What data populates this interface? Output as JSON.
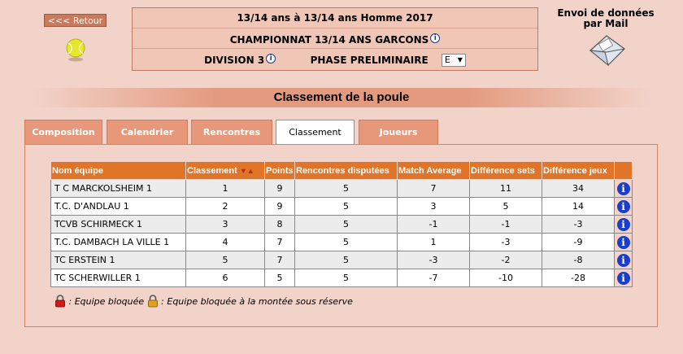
{
  "nav": {
    "back_label": "<<< Retour"
  },
  "header": {
    "line1": "13/14 ans  à 13/14 ans  Homme  2017",
    "championship": "CHAMPIONNAT 13/14 ANS GARCONS",
    "division": "DIVISION 3",
    "phase": "PHASE PRELIMINAIRE",
    "poule_value": "E"
  },
  "mail": {
    "label": "Envoi de données par Mail"
  },
  "section_title": "Classement de la poule",
  "tabs": [
    {
      "label": "Composition"
    },
    {
      "label": "Calendrier"
    },
    {
      "label": "Rencontres"
    },
    {
      "label": "Classement"
    },
    {
      "label": "Joueurs"
    }
  ],
  "table": {
    "headers": [
      "Nom équipe",
      "Classement",
      "Points",
      "Rencontres disputées",
      "Match Average",
      "Différence sets",
      "Différence jeux"
    ],
    "rows": [
      [
        "T C MARCKOLSHEIM 1",
        "1",
        "9",
        "5",
        "7",
        "11",
        "34"
      ],
      [
        "T.C. D'ANDLAU 1",
        "2",
        "9",
        "5",
        "3",
        "5",
        "14"
      ],
      [
        "TCVB SCHIRMECK 1",
        "3",
        "8",
        "5",
        "-1",
        "-1",
        "-3"
      ],
      [
        "T.C. DAMBACH LA VILLE 1",
        "4",
        "7",
        "5",
        "1",
        "-3",
        "-9"
      ],
      [
        "TC ERSTEIN 1",
        "5",
        "7",
        "5",
        "-3",
        "-2",
        "-8"
      ],
      [
        "TC SCHERWILLER 1",
        "6",
        "5",
        "5",
        "-7",
        "-10",
        "-28"
      ]
    ]
  },
  "legend": {
    "blocked": ": Equipe bloquée",
    "blocked_reserve": ": Equipe bloquée à la montée sous réserve"
  }
}
